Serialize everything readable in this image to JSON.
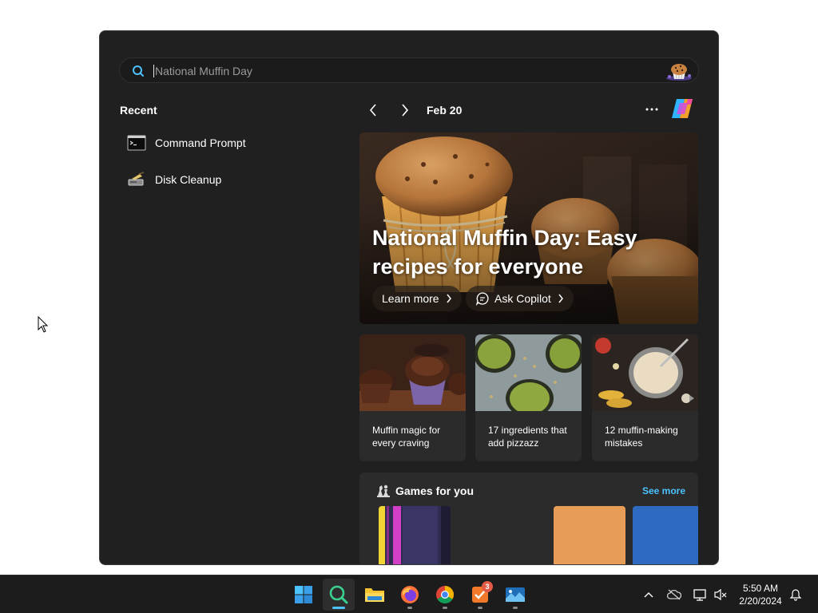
{
  "search": {
    "placeholder": "National Muffin Day",
    "value": ""
  },
  "recent": {
    "title": "Recent",
    "items": [
      {
        "label": "Command Prompt",
        "icon": "command-prompt-icon"
      },
      {
        "label": "Disk Cleanup",
        "icon": "disk-cleanup-icon"
      }
    ]
  },
  "header": {
    "date": "Feb 20"
  },
  "hero": {
    "title": "National Muffin Day: Easy recipes for everyone",
    "learn_more": "Learn more",
    "ask_copilot": "Ask Copilot"
  },
  "cards": [
    {
      "text": "Muffin magic for every craving"
    },
    {
      "text": "17 ingredients that add pizzazz"
    },
    {
      "text": "12 muffin-making mistakes"
    }
  ],
  "games": {
    "title": "Games for you",
    "see_more": "See more"
  },
  "taskbar": {
    "apps": [
      "start",
      "search",
      "file-explorer",
      "firefox",
      "chrome",
      "task-app",
      "photos-app"
    ],
    "notification_badge": "3",
    "time": "5:50 AM",
    "date": "2/20/2024"
  },
  "colors": {
    "panel_bg": "#202020",
    "accent": "#4cc2ff",
    "taskbar_bg": "#1c1c1c"
  }
}
